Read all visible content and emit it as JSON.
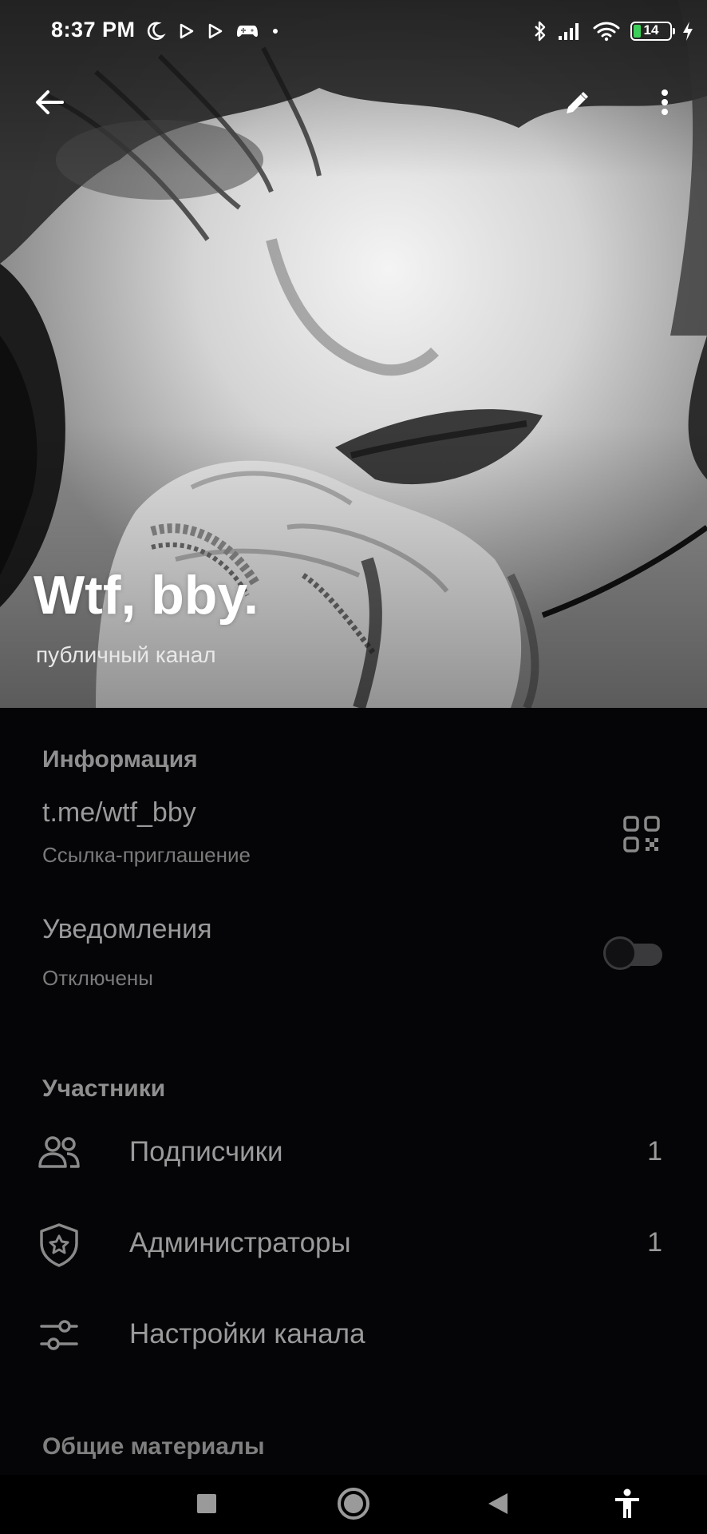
{
  "status_bar": {
    "time": "8:37 PM",
    "battery_level": "14",
    "left_icons": [
      "moon-icon",
      "play-icon",
      "play-icon",
      "gamepad-icon",
      "dot-icon"
    ],
    "right_icons": [
      "bluetooth-icon",
      "signal-icon",
      "wifi-icon",
      "battery-icon",
      "charging-icon"
    ]
  },
  "top_bar": {
    "back_icon": "arrow-left-icon",
    "edit_icon": "pencil-icon",
    "more_icon": "more-vertical-icon"
  },
  "channel": {
    "title": "Wtf, bby.",
    "subtitle": "публичный канал"
  },
  "info_section": {
    "title": "Информация",
    "link": "t.me/wtf_bby",
    "link_caption": "Ссылка-приглашение",
    "qr_icon": "qr-code-icon",
    "notifications_label": "Уведомления",
    "notifications_status": "Отключены",
    "notifications_enabled": false
  },
  "members_section": {
    "title": "Участники",
    "items": [
      {
        "label": "Подписчики",
        "count": "1",
        "icon": "users-icon"
      },
      {
        "label": "Администраторы",
        "count": "1",
        "icon": "shield-star-icon"
      },
      {
        "label": "Настройки канала",
        "count": "",
        "icon": "sliders-icon"
      }
    ]
  },
  "shared_section": {
    "title": "Общие материалы"
  },
  "nav_bar": {
    "icons": [
      "square-icon",
      "circle-icon",
      "triangle-back-icon",
      "accessibility-icon"
    ]
  },
  "colors": {
    "background": "#050407",
    "primary_text": "#9a9a9a",
    "secondary_text": "#7a7a7a",
    "battery_fill": "#3ccf5a"
  }
}
